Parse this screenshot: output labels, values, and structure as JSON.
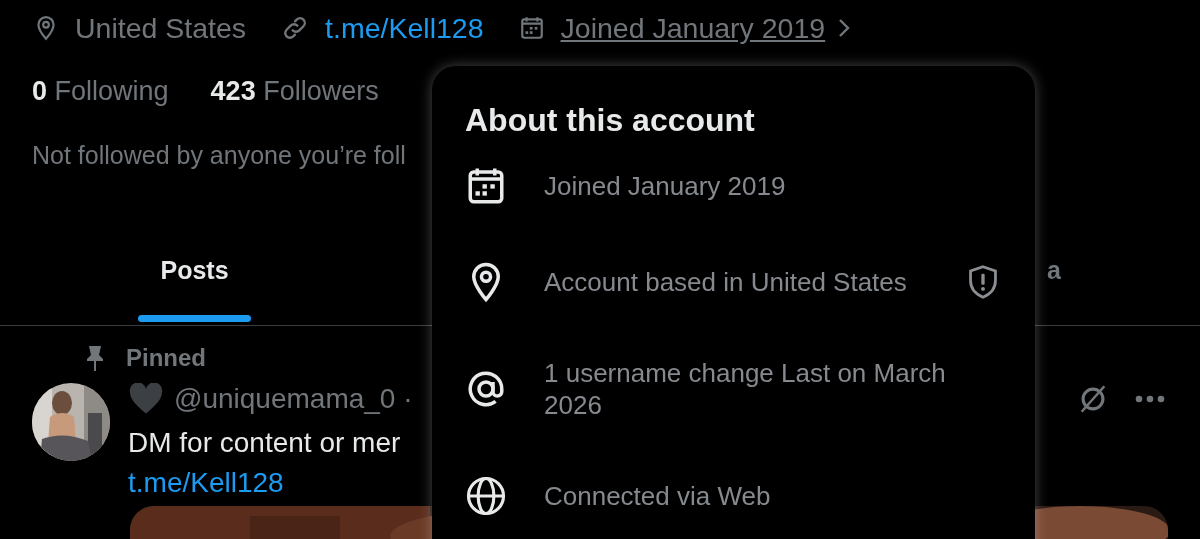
{
  "profile": {
    "location": "United States",
    "link": "t.me/Kell128",
    "joined": "Joined January 2019",
    "following_count": "0",
    "following_label": "Following",
    "followers_count": "423",
    "followers_label": "Followers",
    "followed_by": "Not followed by anyone you’re foll"
  },
  "tabs": [
    {
      "label": "Posts",
      "selected": true
    },
    {
      "label": "a",
      "selected": false
    }
  ],
  "pinned_post": {
    "pinned_label": "Pinned",
    "handle": "@uniquemama_0 ·",
    "text": "DM for content or mer",
    "link": "t.me/Kell128"
  },
  "about_popover": {
    "title": "About this account",
    "items": [
      {
        "kind": "calendar",
        "text": "Joined January 2019",
        "warning": false
      },
      {
        "kind": "location",
        "text": "Account based in United States",
        "warning": true
      },
      {
        "kind": "username",
        "text": "1 username change Last on March 2026",
        "warning": false
      },
      {
        "kind": "globe",
        "text": "Connected via Web",
        "warning": false
      }
    ]
  }
}
